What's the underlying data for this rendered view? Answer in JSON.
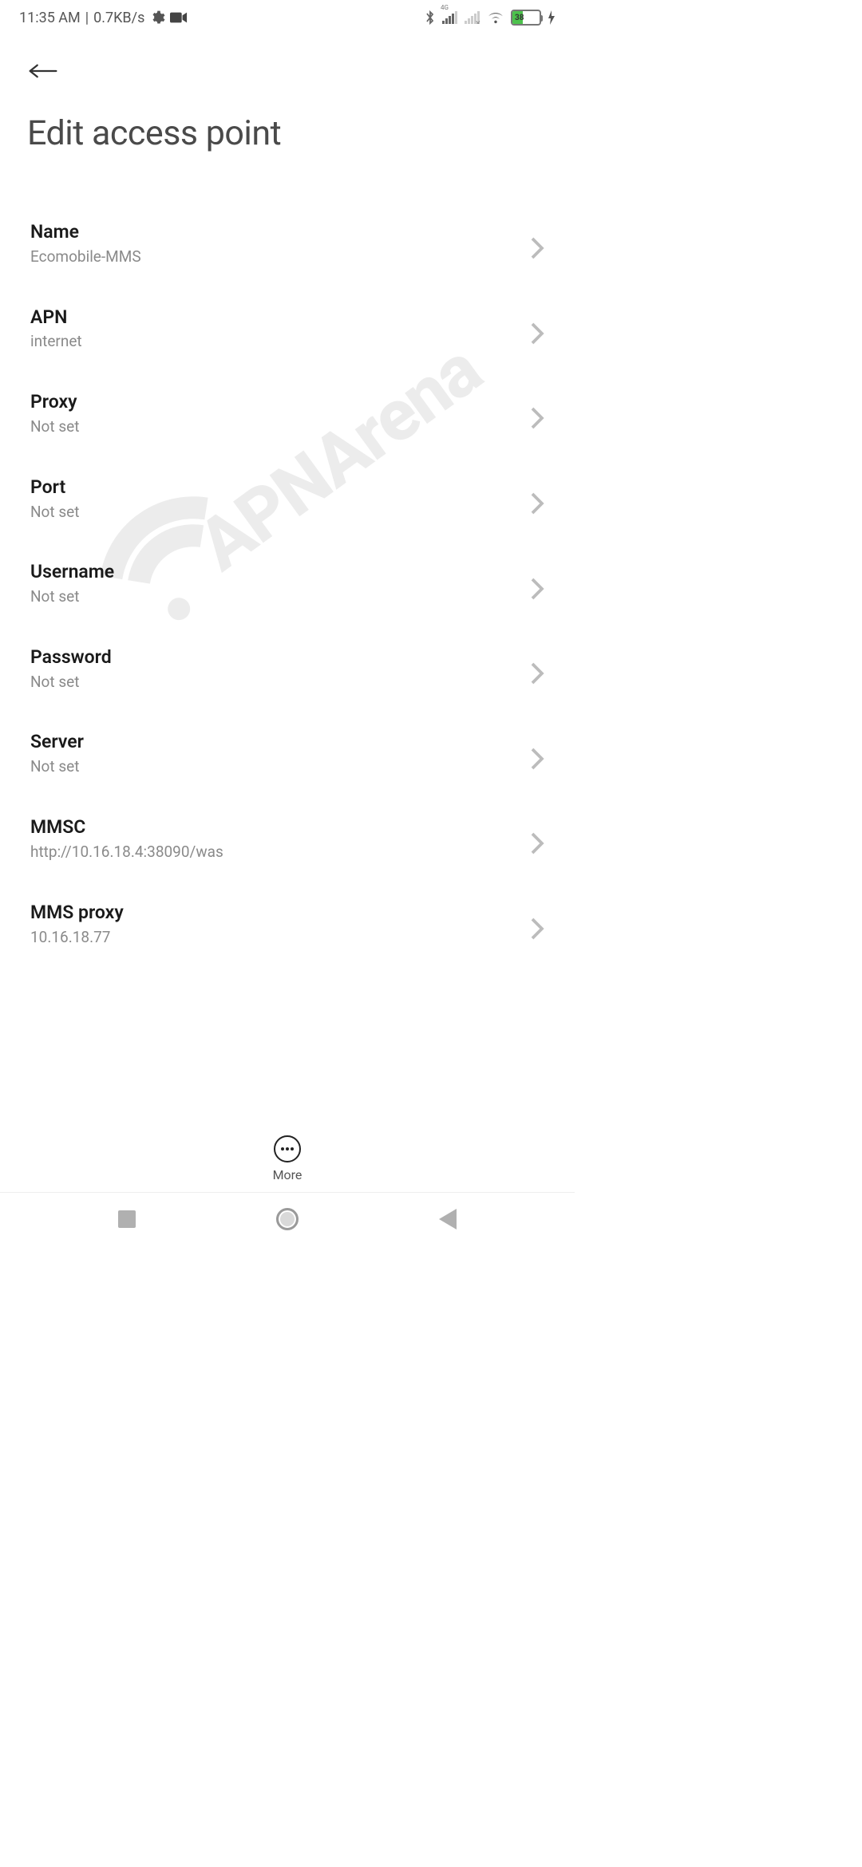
{
  "statusbar": {
    "time": "11:35 AM",
    "net_speed": "0.7KB/s",
    "cell_label": "4G",
    "battery_percent": "38"
  },
  "header": {
    "title": "Edit access point"
  },
  "settings": [
    {
      "label": "Name",
      "value": "Ecomobile-MMS"
    },
    {
      "label": "APN",
      "value": "internet"
    },
    {
      "label": "Proxy",
      "value": "Not set"
    },
    {
      "label": "Port",
      "value": "Not set"
    },
    {
      "label": "Username",
      "value": "Not set"
    },
    {
      "label": "Password",
      "value": "Not set"
    },
    {
      "label": "Server",
      "value": "Not set"
    },
    {
      "label": "MMSC",
      "value": "http://10.16.18.4:38090/was"
    },
    {
      "label": "MMS proxy",
      "value": "10.16.18.77"
    }
  ],
  "footer": {
    "more_label": "More"
  },
  "watermark": {
    "text": "APNArena"
  }
}
